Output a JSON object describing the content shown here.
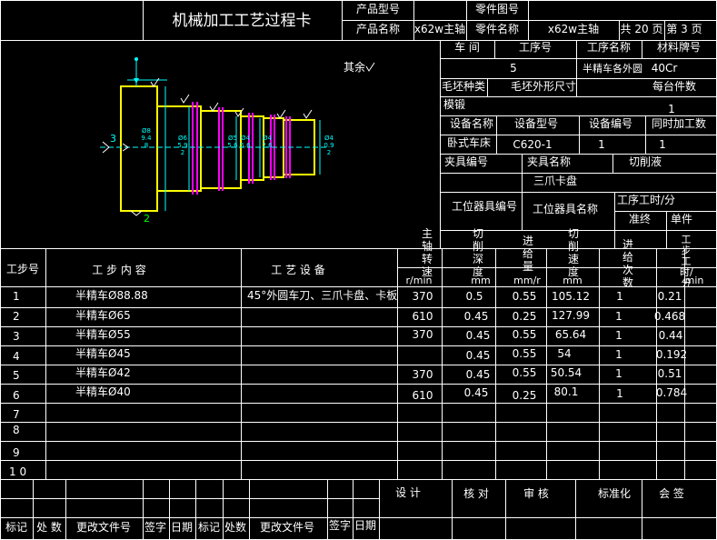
{
  "header": {
    "title": "机械加工工艺过程卡",
    "product_model_label": "产品型号",
    "product_name_label": "产品名称",
    "product_name": "x62w主轴",
    "part_drawing_label": "零件图号",
    "part_name_label": "零件名称",
    "part_name": "x62w主轴",
    "total_pages": "共 20 页",
    "page_no": "第 3 页"
  },
  "drawing": {
    "surface_note": "其余",
    "diameters": [
      "Ø89.48",
      "Ø65.92",
      "Ø55.6",
      "Ø45.6",
      "Ø42.6",
      "Ø40.92"
    ],
    "center_mark": "3",
    "bottom_mark": "2"
  },
  "info": {
    "workshop_label": "车 间",
    "op_no_label": "工序号",
    "op_name_label": "工序名称",
    "material_label": "材料牌号",
    "op_no": "5",
    "op_name": "半精车各外圆",
    "material": "40Cr",
    "blank_type_label": "毛坯种类",
    "blank_size_label": "毛坯外形尺寸",
    "per_blank_label": "每台件数",
    "blank_type": "模锻",
    "per_blank": "1",
    "equip_name_label": "设备名称",
    "equip_model_label": "设备型号",
    "equip_no_label": "设备编号",
    "simul_label": "同时加工数",
    "equip_name": "卧式车床",
    "equip_model": "C620-1",
    "equip_no": "1",
    "simul": "1",
    "fixture_no_label": "夹具编号",
    "fixture_name_label": "夹具名称",
    "coolant_label": "切削液",
    "fixture_name": "三爪卡盘",
    "station_tool_no_label": "工位器具编号",
    "station_tool_name_label": "工位器具名称",
    "op_hours_label": "工序工时/分",
    "prep_label": "准终",
    "unit_label": "单件"
  },
  "steps_header": {
    "step_no": "工步号",
    "content": "工 步 内 容",
    "equipment": "工 艺 设 备",
    "spindle": "主轴转速",
    "spindle_unit": "r/min",
    "depth": "切削深度",
    "depth_unit": "mm",
    "feed": "进给量",
    "feed_unit": "mm/r",
    "speed": "切削速度",
    "speed_unit": "mm",
    "passes": "进给次数",
    "time": "工步工时/分",
    "time_unit": "min"
  },
  "steps": [
    {
      "no": "1",
      "content": "半精车Ø88.88",
      "equipment": "45°外圆车刀、三爪卡盘、卡板",
      "spindle": "370",
      "depth": "0.5",
      "feed": "0.55",
      "speed": "105.12",
      "passes": "1",
      "time": "0.21"
    },
    {
      "no": "2",
      "content": "半精车Ø65",
      "equipment": "",
      "spindle": "610",
      "depth": "0.45",
      "feed": "0.25",
      "speed": "127.99",
      "passes": "1",
      "time": "0.468"
    },
    {
      "no": "3",
      "content": "半精车Ø55",
      "equipment": "",
      "spindle": "370",
      "depth": "0.45",
      "feed": "0.55",
      "speed": "65.64",
      "passes": "1",
      "time": "0.44"
    },
    {
      "no": "4",
      "content": "半精车Ø45",
      "equipment": "",
      "spindle": "",
      "depth": "0.45",
      "feed": "0.55",
      "speed": "54",
      "passes": "1",
      "time": "0.192"
    },
    {
      "no": "5",
      "content": "半精车Ø42",
      "equipment": "",
      "spindle": "370",
      "depth": "0.45",
      "feed": "0.55",
      "speed": "50.54",
      "passes": "1",
      "time": "0.51"
    },
    {
      "no": "6",
      "content": "半精车Ø40",
      "equipment": "",
      "spindle": "610",
      "depth": "0.45",
      "feed": "0.25",
      "speed": "80.1",
      "passes": "1",
      "time": "0.784"
    },
    {
      "no": "7"
    },
    {
      "no": "8"
    },
    {
      "no": "9"
    },
    {
      "no": "1 0"
    }
  ],
  "footer": {
    "design": "设 计",
    "check": "核 对",
    "review": "审 核",
    "standard": "标准化",
    "countersign": "会 签",
    "mark": "标记",
    "count": "处 数",
    "doc_no": "更改文件号",
    "sign": "签字",
    "date": "日期",
    "mark2": "标记",
    "count2": "处数",
    "doc_no2": "更改文件号",
    "sign2": "签字",
    "date2": "日期"
  }
}
